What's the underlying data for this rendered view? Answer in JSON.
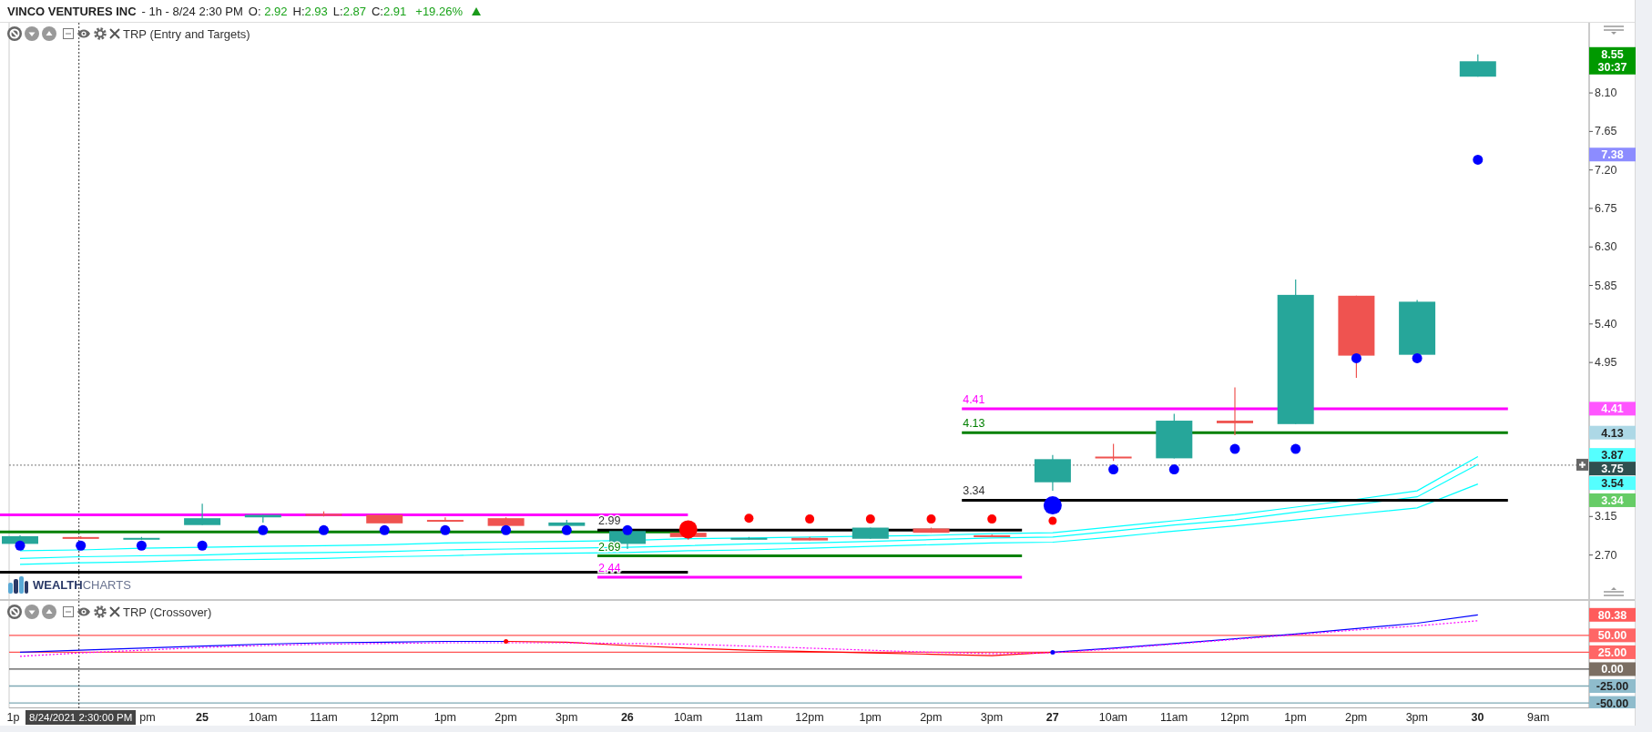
{
  "header": {
    "symbol": "VINCO VENTURES INC",
    "interval": "- 1h - 8/24 2:30 PM",
    "ohlc": [
      {
        "label": "O: ",
        "value": "2.92"
      },
      {
        "label": "H:",
        "value": "2.93"
      },
      {
        "label": "L:",
        "value": "2.87"
      },
      {
        "label": "C:",
        "value": "2.91"
      }
    ],
    "change": "+19.26%",
    "rising": true
  },
  "price_panel": {
    "indicator": "TRP (Entry and Targets)",
    "logo": "**WEALTH**CHARTS",
    "axis_labels": [
      "8.10",
      "7.65",
      "7.20",
      "6.75",
      "6.30",
      "5.85",
      "5.40",
      "4.95",
      "3.15",
      "2.70"
    ],
    "level_labels": [
      {
        "label": "2.99",
        "color": "#333333"
      },
      {
        "label": "2.69",
        "color": "#008000"
      },
      {
        "label": "2.44",
        "color": "#ff00ff"
      },
      {
        "label": "4.41",
        "color": "#ff00ff"
      },
      {
        "label": "4.13",
        "color": "#008000"
      },
      {
        "label": "3.34",
        "color": "#333333"
      }
    ],
    "tags": [
      {
        "label": "8.55",
        "countdown": "30:37",
        "color": "#009900",
        "kind": "price"
      },
      {
        "label": "7.38",
        "color": "#8c8cff",
        "kind": "price"
      },
      {
        "label": "4.41",
        "color": "#ff55ff",
        "kind": "price"
      },
      {
        "label": "4.13",
        "color": "#add8e6",
        "kind": "price"
      },
      {
        "label": "3.87",
        "color": "#55ffff",
        "kind": "price"
      },
      {
        "label": "3.75",
        "color": "#2f4f4f",
        "kind": "crosshair"
      },
      {
        "label": "3.54",
        "color": "#55ffff",
        "kind": "price"
      },
      {
        "label": "3.34",
        "color": "#66cc66",
        "kind": "price"
      }
    ]
  },
  "oscillator_panel": {
    "indicator": "TRP (Crossover)",
    "tags": [
      {
        "label": "80.38",
        "color": "#ff5c5c",
        "kind": "price"
      },
      {
        "label": "50.00",
        "color": "#ff6666",
        "kind": "level"
      },
      {
        "label": "25.00",
        "color": "#ff6666",
        "kind": "level"
      },
      {
        "label": "0.00",
        "color": "#7b6e63",
        "kind": "level"
      },
      {
        "label": "-25.00",
        "color": "#8fbccc",
        "kind": "level"
      },
      {
        "label": "-50.00",
        "color": "#8fbccc",
        "kind": "level"
      }
    ],
    "time_axis": [
      {
        "label": "1p",
        "kind": "hour"
      },
      {
        "label": "8/24/2021 2:30:00 PM",
        "kind": "cursor"
      },
      {
        "label": "pm",
        "kind": "hour"
      },
      {
        "label": "25",
        "kind": "day"
      },
      {
        "label": "10am",
        "kind": "hour"
      },
      {
        "label": "11am",
        "kind": "hour"
      },
      {
        "label": "12pm",
        "kind": "hour"
      },
      {
        "label": "1pm",
        "kind": "hour"
      },
      {
        "label": "2pm",
        "kind": "hour"
      },
      {
        "label": "3pm",
        "kind": "hour"
      },
      {
        "label": "26",
        "kind": "day"
      },
      {
        "label": "10am",
        "kind": "hour"
      },
      {
        "label": "11am",
        "kind": "hour"
      },
      {
        "label": "12pm",
        "kind": "hour"
      },
      {
        "label": "1pm",
        "kind": "hour"
      },
      {
        "label": "2pm",
        "kind": "hour"
      },
      {
        "label": "3pm",
        "kind": "hour"
      },
      {
        "label": "27",
        "kind": "day"
      },
      {
        "label": "10am",
        "kind": "hour"
      },
      {
        "label": "11am",
        "kind": "hour"
      },
      {
        "label": "12pm",
        "kind": "hour"
      },
      {
        "label": "1pm",
        "kind": "hour"
      },
      {
        "label": "2pm",
        "kind": "hour"
      },
      {
        "label": "3pm",
        "kind": "hour"
      },
      {
        "label": "30",
        "kind": "day"
      },
      {
        "label": "9am",
        "kind": "hour"
      }
    ]
  }
}
